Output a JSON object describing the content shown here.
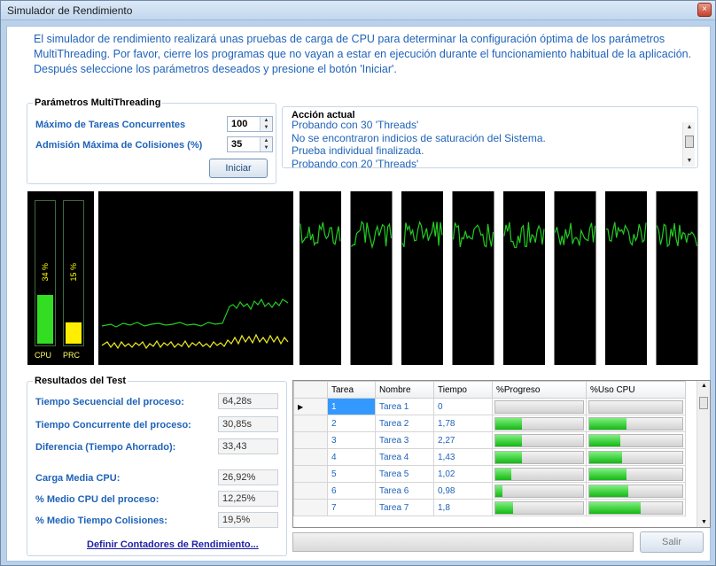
{
  "window": {
    "title": "Simulador de Rendimiento",
    "close_glyph": "×"
  },
  "intro_text": "El simulador de rendimiento realizará unas pruebas de carga de CPU para determinar la configuración óptima de los parámetros MultiThreading. Por favor, cierre los programas que no vayan a estar en ejecución durante el funcionamiento habitual de la aplicación. Después seleccione los parámetros deseados y presione el botón 'Iniciar'.",
  "params": {
    "group_label": "Parámetros MultiThreading",
    "max_tasks_label": "Máximo de Tareas Concurrentes",
    "max_tasks_value": "100",
    "max_collisions_label": "Admisión Máxima de Colisiones (%)",
    "max_collisions_value": "35",
    "start_button": "Iniciar"
  },
  "action": {
    "label": "Acción actual",
    "lines": [
      "Probando con 30 'Threads'",
      "No se encontraron indicios de saturación del Sistema.",
      "Prueba individual finalizada.",
      "Probando con 20 'Threads'"
    ]
  },
  "monitor": {
    "cpu_percent_text": "34 %",
    "prc_percent_text": "15 %",
    "cpu_label": "CPU",
    "prc_label": "PRC",
    "cpu_level": 0.34,
    "prc_level": 0.15,
    "colors": {
      "cpu_green": "#33dd22",
      "prc_yellow": "#ffee00",
      "background": "#000000"
    },
    "thread_panels": 8
  },
  "results": {
    "group_label": "Resultados del Test",
    "rows": [
      {
        "label": "Tiempo Secuencial del proceso:",
        "value": "64,28s"
      },
      {
        "label": "Tiempo Concurrente del proceso:",
        "value": "30,85s"
      },
      {
        "label": "Diferencia (Tiempo Ahorrado):",
        "value": "33,43"
      },
      {
        "label": "Carga Media CPU:",
        "value": "26,92%"
      },
      {
        "label": "% Medio CPU del proceso:",
        "value": "12,25%"
      },
      {
        "label": "% Medio Tiempo Colisiones:",
        "value": "19,5%"
      }
    ],
    "link": "Definir Contadores de Rendimiento..."
  },
  "table": {
    "columns": [
      "Tarea",
      "Nombre",
      "Tiempo",
      "%Progreso",
      "%Uso CPU"
    ],
    "current_row_marker": "▶",
    "rows": [
      {
        "id": "1",
        "name": "Tarea 1",
        "time": "0",
        "progress": 0,
        "cpu": 0
      },
      {
        "id": "2",
        "name": "Tarea 2",
        "time": "1,78",
        "progress": 0.3,
        "cpu": 0.4
      },
      {
        "id": "3",
        "name": "Tarea 3",
        "time": "2,27",
        "progress": 0.3,
        "cpu": 0.33
      },
      {
        "id": "4",
        "name": "Tarea 4",
        "time": "1,43",
        "progress": 0.3,
        "cpu": 0.35
      },
      {
        "id": "5",
        "name": "Tarea 5",
        "time": "1,02",
        "progress": 0.18,
        "cpu": 0.4
      },
      {
        "id": "6",
        "name": "Tarea 6",
        "time": "0,98",
        "progress": 0.08,
        "cpu": 0.42
      },
      {
        "id": "7",
        "name": "Tarea 7",
        "time": "1,8",
        "progress": 0.2,
        "cpu": 0.55
      }
    ]
  },
  "exit_button": "Salir"
}
